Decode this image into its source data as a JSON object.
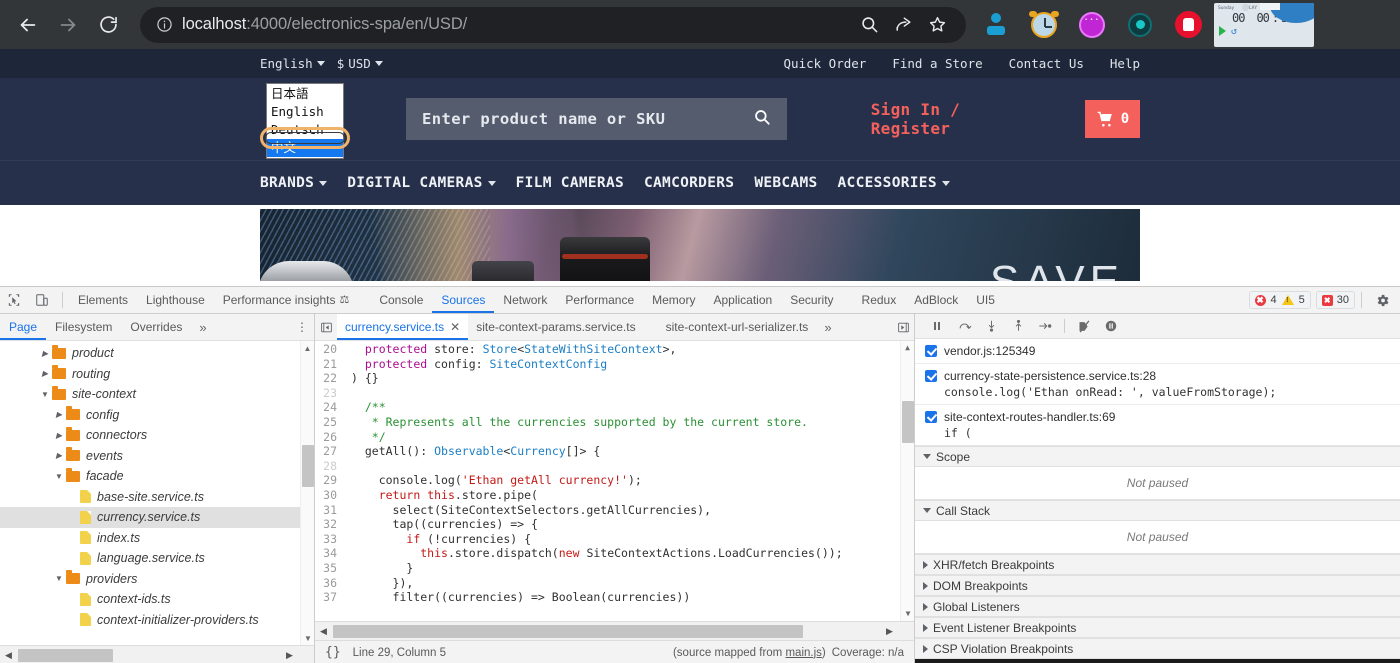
{
  "browser": {
    "back_label": "Back",
    "forward_label": "Forward",
    "reload_label": "Reload",
    "url_host": "localhost",
    "url_rest": ":4000/electronics-spa/en/USD/",
    "search_icon": "search-icon",
    "share_icon": "share-icon",
    "bookmark_icon": "star-icon",
    "extensions": [
      {
        "name": "pin-extension-icon"
      },
      {
        "name": "alarm-clock-extension-icon"
      },
      {
        "name": "purple-circle-extension-icon"
      },
      {
        "name": "teal-eye-extension-icon"
      },
      {
        "name": "stop-hand-extension-icon"
      }
    ],
    "widget": {
      "label_sunday": "Sunday",
      "col1": "PLAY",
      "col2": "WRKR",
      "col3": "MIN",
      "v1": "00",
      "v2": "00",
      "v3": "30",
      "sep": ":"
    }
  },
  "site": {
    "language_label": "English",
    "currency_symbol": "$",
    "currency_label": "USD",
    "top_links": [
      "Quick Order",
      "Find a Store",
      "Contact Us",
      "Help"
    ],
    "search_placeholder": "Enter product name or SKU",
    "sign_in_label": "Sign In / Register",
    "cart_count": "0",
    "nav_items": [
      {
        "label": "BRANDS",
        "caret": true
      },
      {
        "label": "DIGITAL CAMERAS",
        "caret": true
      },
      {
        "label": "FILM CAMERAS",
        "caret": false
      },
      {
        "label": "CAMCORDERS",
        "caret": false
      },
      {
        "label": "WEBCAMS",
        "caret": false
      },
      {
        "label": "ACCESSORIES",
        "caret": true
      }
    ],
    "hero_text": "SAVE",
    "language_dropdown": {
      "options": [
        "日本語",
        "English",
        "Deutsch",
        "中文"
      ],
      "selected": "中文",
      "selected_index": 3
    }
  },
  "devtools": {
    "tabs": [
      {
        "label": "Elements",
        "active": false
      },
      {
        "label": "Lighthouse",
        "active": false
      },
      {
        "label": "Performance insights",
        "active": false,
        "suffix_icon": "beaker-icon"
      },
      {
        "label": "Console",
        "active": false
      },
      {
        "label": "Sources",
        "active": true
      },
      {
        "label": "Network",
        "active": false
      },
      {
        "label": "Performance",
        "active": false
      },
      {
        "label": "Memory",
        "active": false
      },
      {
        "label": "Application",
        "active": false
      },
      {
        "label": "Security",
        "active": false
      },
      {
        "label": "Redux",
        "active": false
      },
      {
        "label": "AdBlock",
        "active": false
      },
      {
        "label": "UI5",
        "active": false
      }
    ],
    "errors_count": "4",
    "warnings_count": "5",
    "blocked_count": "30",
    "settings_icon": "gear-icon",
    "inspect_icon": "inspect-element-icon",
    "device_icon": "device-toolbar-icon",
    "navigator": {
      "tabs": [
        {
          "label": "Page",
          "active": true
        },
        {
          "label": "Filesystem",
          "active": false
        },
        {
          "label": "Overrides",
          "active": false
        }
      ],
      "more_label": "»",
      "kebab_label": "⋮",
      "tree": [
        {
          "label": "product",
          "type": "folder",
          "indent": 2,
          "state": "collapsed",
          "selected": false
        },
        {
          "label": "routing",
          "type": "folder",
          "indent": 2,
          "state": "collapsed",
          "selected": false
        },
        {
          "label": "site-context",
          "type": "folder",
          "indent": 2,
          "state": "expanded",
          "selected": false
        },
        {
          "label": "config",
          "type": "folder",
          "indent": 3,
          "state": "collapsed",
          "selected": false
        },
        {
          "label": "connectors",
          "type": "folder",
          "indent": 3,
          "state": "collapsed",
          "selected": false
        },
        {
          "label": "events",
          "type": "folder",
          "indent": 3,
          "state": "collapsed",
          "selected": false
        },
        {
          "label": "facade",
          "type": "folder",
          "indent": 3,
          "state": "expanded",
          "selected": false
        },
        {
          "label": "base-site.service.ts",
          "type": "file",
          "indent": 4,
          "state": "none",
          "selected": false
        },
        {
          "label": "currency.service.ts",
          "type": "file",
          "indent": 4,
          "state": "none",
          "selected": true
        },
        {
          "label": "index.ts",
          "type": "file",
          "indent": 4,
          "state": "none",
          "selected": false
        },
        {
          "label": "language.service.ts",
          "type": "file",
          "indent": 4,
          "state": "none",
          "selected": false
        },
        {
          "label": "providers",
          "type": "folder",
          "indent": 3,
          "state": "expanded",
          "selected": false
        },
        {
          "label": "context-ids.ts",
          "type": "file",
          "indent": 4,
          "state": "none",
          "selected": false
        },
        {
          "label": "context-initializer-providers.ts",
          "type": "file",
          "indent": 4,
          "state": "none",
          "selected": false
        }
      ]
    },
    "editor": {
      "tabs": [
        {
          "label": "currency.service.ts",
          "active": true,
          "closable": true
        },
        {
          "label": "site-context-params.service.ts",
          "active": false,
          "closable": false
        },
        {
          "label": "site-context-url-serializer.ts",
          "active": false,
          "closable": false
        }
      ],
      "overflow_label": "»",
      "lines": [
        {
          "num": "20",
          "text": "  protected store: Store<StateWithSiteContext>,"
        },
        {
          "num": "21",
          "text": "  protected config: SiteContextConfig"
        },
        {
          "num": "22",
          "text": ") {}"
        },
        {
          "num": "23",
          "text": ""
        },
        {
          "num": "24",
          "text": "  /**"
        },
        {
          "num": "25",
          "text": "   * Represents all the currencies supported by the current store."
        },
        {
          "num": "26",
          "text": "   */"
        },
        {
          "num": "27",
          "text": "  getAll(): Observable<Currency[]> {"
        },
        {
          "num": "28",
          "text": ""
        },
        {
          "num": "29",
          "text": "    console.log('Ethan getAll currency!');"
        },
        {
          "num": "30",
          "text": "    return this.store.pipe("
        },
        {
          "num": "31",
          "text": "      select(SiteContextSelectors.getAllCurrencies),"
        },
        {
          "num": "32",
          "text": "      tap((currencies) => {"
        },
        {
          "num": "33",
          "text": "        if (!currencies) {"
        },
        {
          "num": "34",
          "text": "          this.store.dispatch(new SiteContextActions.LoadCurrencies());"
        },
        {
          "num": "35",
          "text": "        }"
        },
        {
          "num": "36",
          "text": "      }),"
        },
        {
          "num": "37",
          "text": "      filter((currencies) => Boolean(currencies))"
        }
      ],
      "status": {
        "format_icon": "pretty-print-icon",
        "cursor": "Line 29, Column 5",
        "source_map": "(source mapped from ",
        "source_map_link": "main.js",
        "source_map_tail": ")",
        "coverage": "Coverage: n/a"
      }
    },
    "debugger": {
      "controls": [
        {
          "name": "pause-script-icon"
        },
        {
          "name": "step-over-icon"
        },
        {
          "name": "step-into-icon"
        },
        {
          "name": "step-out-icon"
        },
        {
          "name": "step-icon"
        },
        {
          "name": "deactivate-breakpoints-icon"
        },
        {
          "name": "pause-on-exceptions-icon"
        }
      ],
      "breakpoints": [
        {
          "label": "vendor.js:125349",
          "code": "",
          "checked": true
        },
        {
          "label": "currency-state-persistence.service.ts:28",
          "code": "console.log('Ethan onRead: ', valueFromStorage);",
          "checked": true
        },
        {
          "label": "site-context-routes-handler.ts:69",
          "code": "if (",
          "checked": true
        }
      ],
      "sections": [
        {
          "label": "Scope",
          "expanded": true,
          "body": "Not paused"
        },
        {
          "label": "Call Stack",
          "expanded": true,
          "body": "Not paused"
        },
        {
          "label": "XHR/fetch Breakpoints",
          "expanded": false,
          "body": null
        },
        {
          "label": "DOM Breakpoints",
          "expanded": false,
          "body": null
        },
        {
          "label": "Global Listeners",
          "expanded": false,
          "body": null
        },
        {
          "label": "Event Listener Breakpoints",
          "expanded": false,
          "body": null
        },
        {
          "label": "CSP Violation Breakpoints",
          "expanded": false,
          "body": null
        }
      ]
    }
  }
}
